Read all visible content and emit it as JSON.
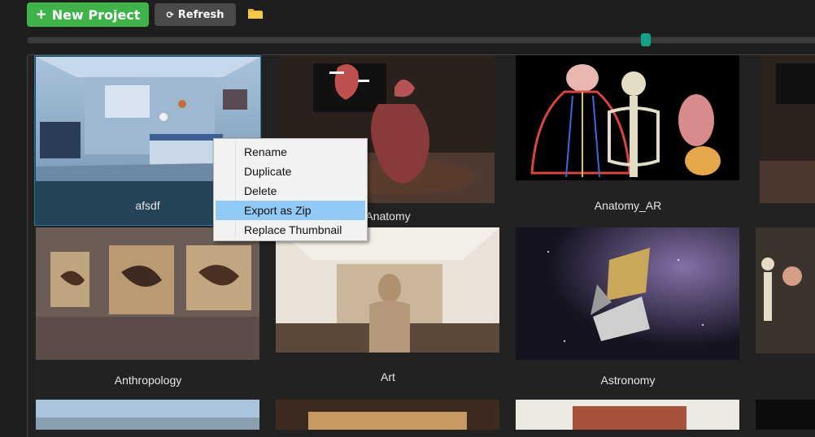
{
  "toolbar": {
    "new_project_label": "New Project",
    "refresh_label": "Refresh",
    "colors": {
      "new_project_bg": "#3fb34a",
      "refresh_bg": "#4a4a4a",
      "folder": "#f0b429"
    }
  },
  "slider": {
    "value_fraction": 0.78,
    "thumb_color": "#12a386"
  },
  "projects": [
    {
      "name": "afsdf",
      "selected": true
    },
    {
      "name": "Anatomy",
      "selected": false
    },
    {
      "name": "Anatomy_AR",
      "selected": false
    },
    {
      "name": "",
      "selected": false
    },
    {
      "name": "Anthropology",
      "selected": false
    },
    {
      "name": "Art",
      "selected": false
    },
    {
      "name": "Astronomy",
      "selected": false
    },
    {
      "name": "",
      "selected": false
    },
    {
      "name": "",
      "selected": false
    },
    {
      "name": "",
      "selected": false
    },
    {
      "name": "",
      "selected": false
    },
    {
      "name": "",
      "selected": false
    }
  ],
  "context_menu": {
    "items": [
      "Rename",
      "Duplicate",
      "Delete",
      "Export as Zip",
      "Replace Thumbnail"
    ],
    "highlighted_index": 3,
    "highlight_color": "#91c9f7"
  }
}
